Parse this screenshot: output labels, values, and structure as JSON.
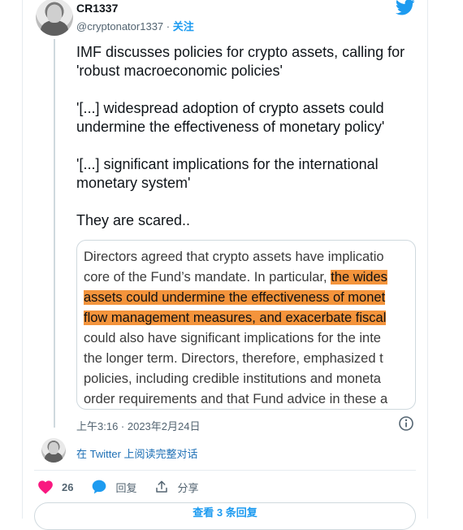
{
  "user": {
    "name": "CR1337",
    "handle": "@cryptonator1337",
    "separator": " · ",
    "follow_label": "关注"
  },
  "tweet": {
    "paragraphs": [
      [
        "IMF discusses policies for crypto assets, calling for",
        "'robust macroeconomic policies'"
      ],
      [
        "'[...] widespread adoption of crypto assets could",
        "undermine the effectiveness of monetary policy'"
      ],
      [
        "'[...] significant implications for the international",
        "monetary system'"
      ],
      [
        "They are scared.."
      ]
    ]
  },
  "quote_image": {
    "lines": [
      {
        "plain": "Directors agreed that crypto assets have implicatio",
        "highlight": ""
      },
      {
        "plain": "core of the Fund’s mandate. In particular, ",
        "highlight": "the wides"
      },
      {
        "plain": "",
        "highlight": "assets could undermine the effectiveness of monet"
      },
      {
        "plain": "",
        "highlight": "flow management measures, and exacerbate fiscal"
      },
      {
        "plain": "could also have significant implications for the inte",
        "highlight": ""
      },
      {
        "plain": "the longer term. Directors, therefore, emphasized t",
        "highlight": ""
      },
      {
        "plain": "policies, including credible institutions and moneta",
        "highlight": ""
      },
      {
        "plain": "order requirements and that Fund advice in these a",
        "highlight": ""
      }
    ],
    "highlight_color": "#f4943c"
  },
  "timestamp": "上午3:16 · 2023年2月24日",
  "read_full_thread": "在 Twitter 上阅读完整对话",
  "actions": {
    "like_count": "26",
    "reply_label": "回复",
    "share_label": "分享"
  },
  "more_replies_label": "查看 3 条回复",
  "colors": {
    "accent": "#1d9bf0",
    "like": "#f91880",
    "text": "#0f1419",
    "muted": "#536471"
  },
  "icons": {
    "brand": "twitter-bird-icon",
    "info": "info-icon",
    "like": "heart-icon",
    "reply": "reply-bubble-icon",
    "share": "share-icon"
  }
}
